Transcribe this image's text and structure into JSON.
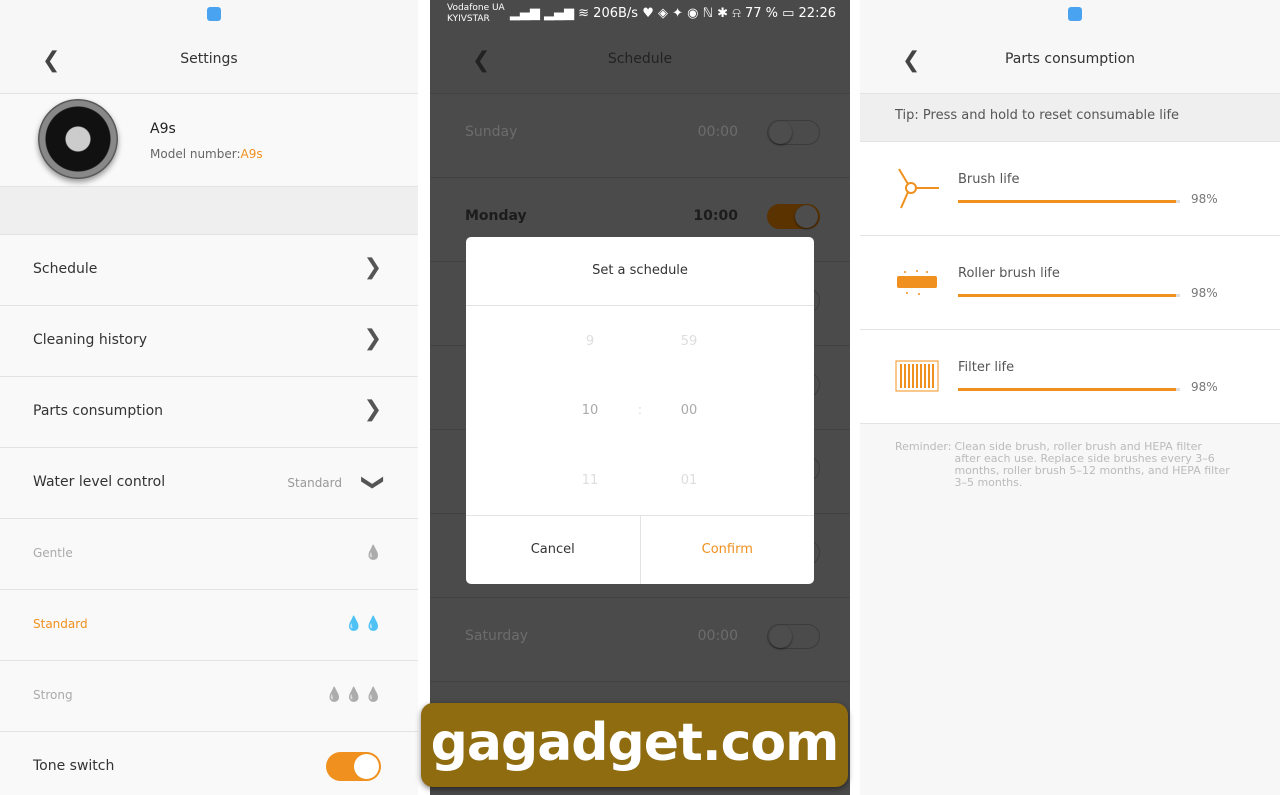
{
  "settings": {
    "title": "Settings",
    "device": {
      "name": "A9s",
      "model_label": "Model number:",
      "model_value": "A9s"
    },
    "menu": [
      {
        "label": "Schedule"
      },
      {
        "label": "Cleaning history"
      },
      {
        "label": "Parts consumption"
      }
    ],
    "water": {
      "label": "Water level control",
      "value": "Standard",
      "options": [
        {
          "label": "Gentle",
          "drops": "💧"
        },
        {
          "label": "Standard",
          "drops": "💧💧",
          "selected": true
        },
        {
          "label": "Strong",
          "drops": "💧💧💧"
        }
      ]
    },
    "tone": {
      "label": "Tone switch",
      "on": true
    }
  },
  "schedule": {
    "status": {
      "carrier1": "Vodafone UA",
      "carrier2": "KYIVSTAR",
      "net": "206B/s",
      "battery": "77 %",
      "time": "22:26"
    },
    "title": "Schedule",
    "days": [
      {
        "name": "Sunday",
        "time": "00:00",
        "on": false
      },
      {
        "name": "Monday",
        "time": "10:00",
        "on": true
      },
      {
        "name": "Saturday",
        "time": "00:00",
        "on": false
      }
    ],
    "dialog": {
      "title": "Set a schedule",
      "hours": [
        "9",
        "10",
        "11"
      ],
      "minutes": [
        "59",
        "00",
        "01"
      ],
      "sep": ":",
      "cancel": "Cancel",
      "confirm": "Confirm"
    }
  },
  "parts": {
    "title": "Parts consumption",
    "tip": "Tip: Press and hold to reset consumable life",
    "items": [
      {
        "label": "Brush life",
        "percent": "98%",
        "value": 98,
        "icon": "side-brush-icon"
      },
      {
        "label": "Roller brush life",
        "percent": "98%",
        "value": 98,
        "icon": "roller-brush-icon"
      },
      {
        "label": "Filter life",
        "percent": "98%",
        "value": 98,
        "icon": "filter-icon"
      }
    ],
    "reminder_label": "Reminder:",
    "reminder": "Clean side brush, roller brush and HEPA filter after each use. Replace side brushes every 3–6 months, roller brush 5–12 months, and HEPA filter 3–5 months."
  },
  "watermark": "gagadget.com",
  "colors": {
    "accent": "#f0901e"
  }
}
